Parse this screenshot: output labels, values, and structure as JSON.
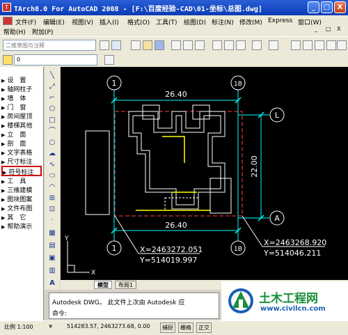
{
  "window": {
    "title": "TArch8.0 For AutoCAD 2008 - [F:\\百度经验-CAD\\01-坐标\\总图.dwg]",
    "app_icon": "cad-app-icon",
    "buttons": {
      "minimize": "_",
      "maximize": "□",
      "close": "X"
    }
  },
  "menubar": {
    "row1": [
      "文件(F)",
      "编辑(E)",
      "视图(V)",
      "插入(I)",
      "格式(O)",
      "工具(T)",
      "绘图(D)",
      "标注(N)",
      "修改(M)",
      "Express",
      "窗口(W)"
    ],
    "row2": [
      "帮助(H)",
      "附加(P)"
    ],
    "doc_controls": [
      "_",
      "□",
      "X"
    ]
  },
  "toolbar": {
    "workspace_combo": "二维草图与注释",
    "layer_combo": "0",
    "icons": [
      "new-icon",
      "open-icon",
      "save-icon",
      "print-icon",
      "preview-icon",
      "publish-icon",
      "cut-icon",
      "copy-icon",
      "paste-icon",
      "matchprop-icon",
      "undo-icon",
      "redo-icon",
      "pan-icon",
      "zoom-icon",
      "zoom-window-icon",
      "zoom-previous-icon",
      "properties-icon",
      "designcenter-icon",
      "toolpalette-icon",
      "help-icon"
    ]
  },
  "left_panel": {
    "items": [
      {
        "label": "设　置"
      },
      {
        "label": "轴网柱子"
      },
      {
        "label": "墙　体"
      },
      {
        "label": "门　窗"
      },
      {
        "label": "房间屋顶"
      },
      {
        "label": "楼梯其他"
      },
      {
        "label": "立　面"
      },
      {
        "label": "剖　面"
      },
      {
        "label": "文字表格"
      },
      {
        "label": "尺寸标注"
      },
      {
        "label": "符号标注",
        "active": true
      },
      {
        "label": "工　具"
      },
      {
        "label": "三维建模"
      },
      {
        "label": "图块图案"
      },
      {
        "label": "文件布图"
      },
      {
        "label": "其　它"
      },
      {
        "label": "帮助演示"
      }
    ]
  },
  "drawing": {
    "axis_labels": {
      "top_left": "1",
      "top_right": "1B",
      "bottom_left": "1",
      "bottom_right": "1B",
      "right_top": "L",
      "right_bottom": "A"
    },
    "dimensions": {
      "top_width": "26.40",
      "bottom_width": "26.40",
      "right_height": "22.00"
    },
    "coordinates": {
      "left": {
        "x": "X=2463272.051",
        "y": "Y=514019.997"
      },
      "right": {
        "x": "X=2463268.920",
        "y": "Y=514046.211"
      }
    },
    "ucs": {
      "x": "X",
      "y": "Y"
    },
    "colors": {
      "background": "#000000",
      "wall": "#ffffff",
      "dim": "#00ffff",
      "border": "#ff4040",
      "highlight": "#ffff00"
    }
  },
  "tabs": [
    "模型",
    "布局1"
  ],
  "command": {
    "line1": "Autodesk DWG。 此文件上次由 Autodesk 应",
    "prompt": "命令:"
  },
  "statusbar": {
    "scale": "比例 1:100",
    "coords": "514283.57,  2463273.68, 0.00",
    "buttons": [
      "捕捉",
      "栅格",
      "正交"
    ]
  },
  "watermark": {
    "brand": "土木工程网",
    "url": "www.civilcn.com"
  }
}
